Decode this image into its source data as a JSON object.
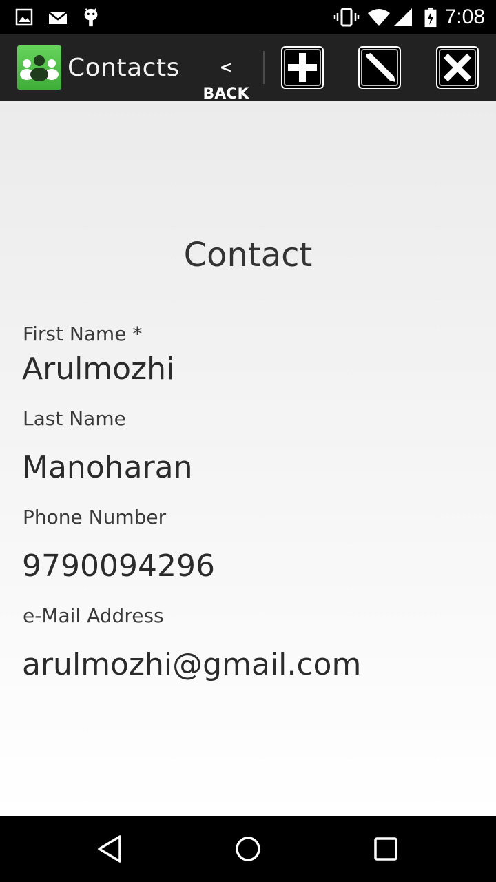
{
  "status_bar": {
    "time": "7:08",
    "left_icons": [
      "image-notification-icon",
      "email-notification-icon",
      "android-debug-icon"
    ],
    "right_icons": [
      "vibrate-icon",
      "wifi-icon",
      "cell-signal-icon",
      "battery-charging-icon"
    ]
  },
  "action_bar": {
    "title": "Contacts",
    "back_label": "< BACK",
    "buttons": [
      "add-icon",
      "edit-icon",
      "delete-icon"
    ]
  },
  "contact": {
    "heading": "Contact",
    "fields": [
      {
        "label": "First Name *",
        "value": "Arulmozhi"
      },
      {
        "label": "Last Name",
        "value": "Manoharan"
      },
      {
        "label": "Phone Number",
        "value": "9790094296"
      },
      {
        "label": "e-Mail Address",
        "value": "arulmozhi@gmail.com"
      }
    ]
  },
  "nav_bar": {
    "buttons": [
      "back-triangle-icon",
      "home-circle-icon",
      "recents-square-icon"
    ]
  },
  "colors": {
    "action_bar_bg": "#222222",
    "logo_green": "#4cbf45",
    "text_dark": "#2b2b2b"
  }
}
